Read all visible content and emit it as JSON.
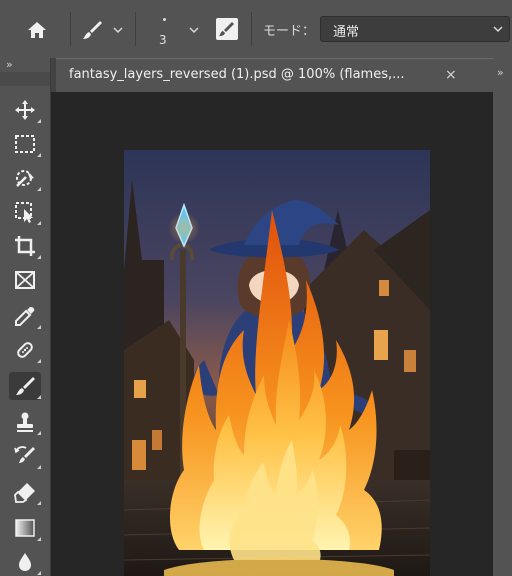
{
  "options_bar": {
    "brush_size": "3",
    "mode_label": "モード：",
    "mode_value": "通常"
  },
  "document_tab": {
    "title": "fantasy_layers_reversed (1).psd @ 100% (flames,...",
    "close_glyph": "×"
  },
  "toolbar": {
    "collapse_glyph": "»",
    "tools": [
      {
        "name": "move-tool",
        "active": false
      },
      {
        "name": "rectangular-marquee-tool",
        "active": false
      },
      {
        "name": "object-selection-tool",
        "active": false
      },
      {
        "name": "crop-tool",
        "active": false
      },
      {
        "name": "frame-tool",
        "active": false
      },
      {
        "name": "eyedropper-tool",
        "active": false
      },
      {
        "name": "spot-healing-brush-tool",
        "active": false
      },
      {
        "name": "brush-tool",
        "active": true
      },
      {
        "name": "clone-stamp-tool",
        "active": false
      },
      {
        "name": "history-brush-tool",
        "active": false
      },
      {
        "name": "eraser-tool",
        "active": false
      },
      {
        "name": "gradient-tool",
        "active": false
      },
      {
        "name": "blur-tool",
        "active": false
      }
    ]
  },
  "right_panel": {
    "collapse_glyph": "»"
  },
  "colors": {
    "ui_panel": "#535353",
    "ui_dark": "#262626",
    "flame": "#f07a14",
    "witch_robe": "#2c3f78"
  }
}
